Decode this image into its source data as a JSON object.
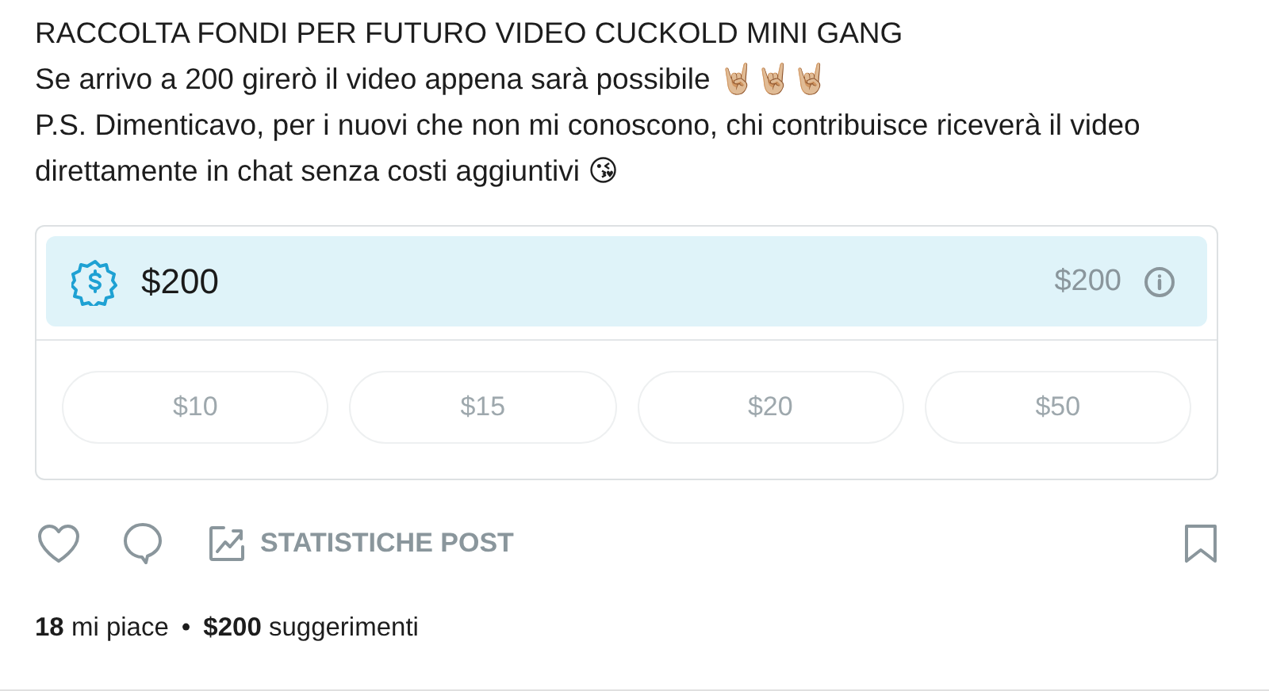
{
  "post": {
    "lines": [
      "RACCOLTA FONDI PER FUTURO VIDEO CUCKOLD MINI GANG",
      "Se arrivo a 200 girerò il video appena sarà possibile 🤘🏼🤘🏼🤘🏼",
      "P.S. Dimenticavo, per i nuovi che non mi conoscono, chi contribuisce riceverà il video direttamente in chat senza costi aggiuntivi 😘"
    ]
  },
  "fundraiser": {
    "amount": "$200",
    "goal": "$200",
    "tips": [
      "$10",
      "$15",
      "$20",
      "$50"
    ]
  },
  "actions": {
    "stats_label": "STATISTICHE POST",
    "bookmarked": false,
    "liked": false
  },
  "summary": [
    {
      "text": "**18** mi piace"
    },
    {
      "text": "•"
    },
    {
      "text": "**$200** suggerimenti"
    }
  ]
}
